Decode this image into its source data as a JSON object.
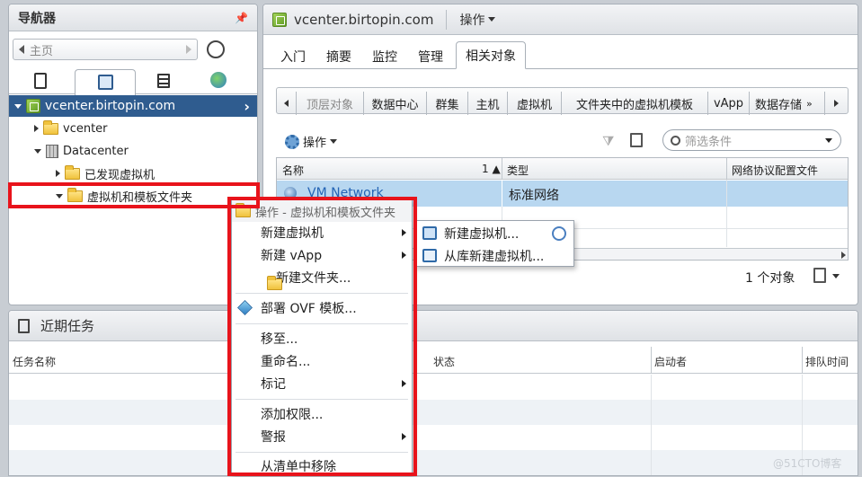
{
  "navigator": {
    "title": "导航器",
    "home": "主页",
    "tree": {
      "root": "vcenter.birtopin.com",
      "vcenter": "vcenter",
      "datacenter": "Datacenter",
      "discovered_vms": "已发现虚拟机",
      "vm_template_folder": "虚拟机和模板文件夹"
    }
  },
  "main": {
    "title": "vcenter.birtopin.com",
    "actions": "操作",
    "tabs": [
      "入门",
      "摘要",
      "监控",
      "管理",
      "相关对象"
    ],
    "active_tab": "相关对象",
    "crumbs": [
      "顶层对象",
      "数据中心",
      "群集",
      "主机",
      "虚拟机",
      "文件夹中的虚拟机模板",
      "vApp",
      "数据存储"
    ],
    "toolbar": {
      "actions": "操作",
      "filter_placeholder": "筛选条件"
    },
    "table": {
      "columns": [
        "名称",
        "1 ▲",
        "类型",
        "网络协议配置文件"
      ],
      "rows": [
        {
          "name": "VM Network",
          "type": "标准网络"
        }
      ]
    },
    "footer_count": "1 个对象"
  },
  "tasks": {
    "title": "近期任务",
    "columns": [
      "任务名称",
      "状态",
      "启动者",
      "排队时间"
    ]
  },
  "context_menu": {
    "header": "操作 - 虚拟机和模板文件夹",
    "items": {
      "new_vm": "新建虚拟机",
      "new_vapp": "新建 vApp",
      "new_folder": "新建文件夹...",
      "deploy_ovf": "部署 OVF 模板...",
      "move_to": "移至...",
      "rename": "重命名...",
      "tags": "标记",
      "add_permission": "添加权限...",
      "alarms": "警报",
      "remove_inventory": "从清单中移除"
    }
  },
  "submenu": {
    "new_vm": "新建虚拟机...",
    "new_vm_from_library": "从库新建虚拟机..."
  },
  "watermark": "@51CTO博客",
  "colors": {
    "selection": "#2f5c8f",
    "highlight_red": "#e8131b",
    "row_selected": "#b8d7f0"
  }
}
